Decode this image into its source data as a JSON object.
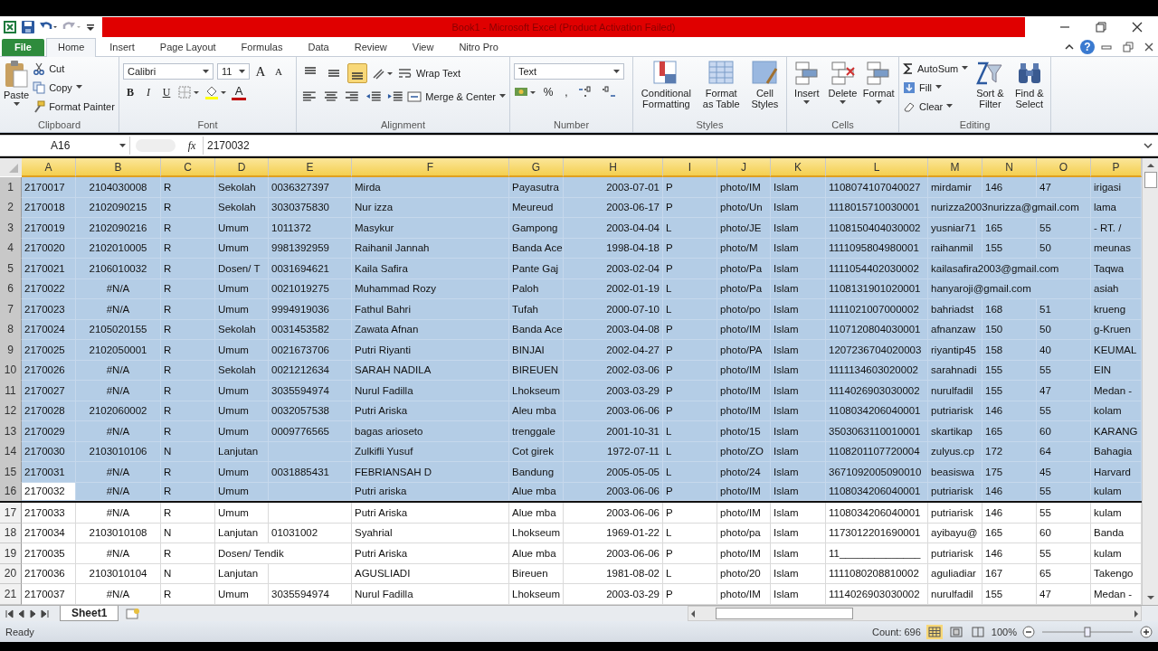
{
  "window": {
    "title": "Book1 - Microsoft Excel (Product Activation Failed)",
    "help": "?"
  },
  "ribbon_tabs": [
    {
      "label": "File",
      "kind": "file",
      "selected": false
    },
    {
      "label": "Home",
      "kind": "tab",
      "selected": true
    },
    {
      "label": "Insert",
      "kind": "tab",
      "selected": false
    },
    {
      "label": "Page Layout",
      "kind": "tab",
      "selected": false
    },
    {
      "label": "Formulas",
      "kind": "tab",
      "selected": false
    },
    {
      "label": "Data",
      "kind": "tab",
      "selected": false
    },
    {
      "label": "Review",
      "kind": "tab",
      "selected": false
    },
    {
      "label": "View",
      "kind": "tab",
      "selected": false
    },
    {
      "label": "Nitro Pro",
      "kind": "tab",
      "selected": false
    }
  ],
  "ribbon": {
    "clipboard": {
      "paste": "Paste",
      "cut": "Cut",
      "copy": "Copy",
      "format_painter": "Format Painter",
      "label": "Clipboard"
    },
    "font": {
      "name": "Calibri",
      "size": "11",
      "grow": "A",
      "shrink": "A",
      "bold": "B",
      "italic": "I",
      "underline": "U",
      "font_color": "A",
      "label": "Font"
    },
    "alignment": {
      "vertical": [
        {
          "selected": false
        },
        {
          "selected": false
        },
        {
          "selected": true
        }
      ],
      "wrap_text": "Wrap Text",
      "merge": "Merge & Center",
      "label": "Alignment"
    },
    "number": {
      "format": "Text",
      "percent": "%",
      "comma": ",",
      "label": "Number"
    },
    "styles": {
      "conditional": "Conditional Formatting",
      "table": "Format as Table",
      "cell": "Cell Styles",
      "label": "Styles"
    },
    "cells": {
      "insert": "Insert",
      "delete": "Delete",
      "format": "Format",
      "label": "Cells"
    },
    "editing": {
      "autosum": "AutoSum",
      "fill": "Fill",
      "clear": "Clear",
      "sort": "Sort & Filter",
      "find": "Find & Select",
      "label": "Editing"
    }
  },
  "formula_bar": {
    "name_box": "A16",
    "fx": "fx",
    "value": "2170032"
  },
  "table": {
    "columns": [
      {
        "label": "A",
        "selected": true
      },
      {
        "label": "B",
        "selected": true
      },
      {
        "label": "C",
        "selected": true
      },
      {
        "label": "D",
        "selected": true
      },
      {
        "label": "E",
        "selected": true
      },
      {
        "label": "F",
        "selected": true
      },
      {
        "label": "G",
        "selected": true
      },
      {
        "label": "H",
        "selected": true
      },
      {
        "label": "I",
        "selected": true
      },
      {
        "label": "J",
        "selected": true
      },
      {
        "label": "K",
        "selected": true
      },
      {
        "label": "L",
        "selected": true
      },
      {
        "label": "M",
        "selected": true
      },
      {
        "label": "N",
        "selected": true
      },
      {
        "label": "O",
        "selected": true
      },
      {
        "label": "P",
        "selected": true
      }
    ],
    "rows": [
      {
        "number": "1",
        "selected": true,
        "active": false,
        "cells": [
          "2170017",
          "2104030008",
          "R",
          "Sekolah",
          "0036327397",
          "Mirda",
          "Payasutra",
          "2003-07-01",
          "P",
          "photo/IM",
          "Islam",
          "1108074107040027",
          "mirdamir",
          "146",
          "47",
          "irigasi"
        ]
      },
      {
        "number": "2",
        "selected": true,
        "active": false,
        "cells": [
          "2170018",
          "2102090215",
          "R",
          "Sekolah",
          "3030375830",
          "Nur izza",
          "Meureud",
          "2003-06-17",
          "P",
          "photo/Un",
          "Islam",
          "1118015710030001",
          "nurizza2003nurizza@gmail.com",
          null,
          null,
          "lama"
        ]
      },
      {
        "number": "3",
        "selected": true,
        "active": false,
        "cells": [
          "2170019",
          "2102090216",
          "R",
          "Umum",
          "1011372",
          "Masykur",
          "Gampong",
          "2003-04-04",
          "L",
          "photo/JE",
          "Islam",
          "1108150404030002",
          "yusniar71",
          "165",
          "55",
          "- RT. /"
        ]
      },
      {
        "number": "4",
        "selected": true,
        "active": false,
        "cells": [
          "2170020",
          "2102010005",
          "R",
          "Umum",
          "9981392959",
          "Raihanil Jannah",
          "Banda Ace",
          "1998-04-18",
          "P",
          "photo/M",
          "Islam",
          "1111095804980001",
          "raihanmil",
          "155",
          "50",
          "meunas"
        ]
      },
      {
        "number": "5",
        "selected": true,
        "active": false,
        "cells": [
          "2170021",
          "2106010032",
          "R",
          "Dosen/ T",
          "0031694621",
          "Kaila Safira",
          "Pante Gaj",
          "2003-02-04",
          "P",
          "photo/Pa",
          "Islam",
          "1111054402030002",
          "kailasafira2003@gmail.com",
          null,
          null,
          "Taqwa"
        ]
      },
      {
        "number": "6",
        "selected": true,
        "active": false,
        "cells": [
          "2170022",
          "#N/A",
          "R",
          "Umum",
          "0021019275",
          "Muhammad Rozy",
          "Paloh",
          "2002-01-19",
          "L",
          "photo/Pa",
          "Islam",
          "1108131901020001",
          "hanyaroji@gmail.com",
          null,
          null,
          "asiah"
        ]
      },
      {
        "number": "7",
        "selected": true,
        "active": false,
        "cells": [
          "2170023",
          "#N/A",
          "R",
          "Umum",
          "9994919036",
          "Fathul Bahri",
          "Tufah",
          "2000-07-10",
          "L",
          "photo/po",
          "Islam",
          "1111021007000002",
          "bahriadst",
          "168",
          "51",
          "krueng"
        ]
      },
      {
        "number": "8",
        "selected": true,
        "active": false,
        "cells": [
          "2170024",
          "2105020155",
          "R",
          "Sekolah",
          "0031453582",
          "Zawata Afnan",
          "Banda Ace",
          "2003-04-08",
          "P",
          "photo/IM",
          "Islam",
          "1107120804030001",
          "afnanzaw",
          "150",
          "50",
          "g-Kruen"
        ]
      },
      {
        "number": "9",
        "selected": true,
        "active": false,
        "cells": [
          "2170025",
          "2102050001",
          "R",
          "Umum",
          "0021673706",
          "Putri Riyanti",
          "BINJAI",
          "2002-04-27",
          "P",
          "photo/PA",
          "Islam",
          "1207236704020003",
          "riyantip45",
          "158",
          "40",
          "KEUMAL"
        ]
      },
      {
        "number": "10",
        "selected": true,
        "active": false,
        "cells": [
          "2170026",
          "#N/A",
          "R",
          "Sekolah",
          "0021212634",
          "SARAH NADILA",
          "BIREUEN",
          "2002-03-06",
          "P",
          "photo/IM",
          "Islam",
          "1111134603020002",
          "sarahnadi",
          "155",
          "55",
          "EIN"
        ]
      },
      {
        "number": "11",
        "selected": true,
        "active": false,
        "cells": [
          "2170027",
          "#N/A",
          "R",
          "Umum",
          "3035594974",
          "Nurul Fadilla",
          "Lhokseum",
          "2003-03-29",
          "P",
          "photo/IM",
          "Islam",
          "1114026903030002",
          "nurulfadil",
          "155",
          "47",
          "Medan -"
        ]
      },
      {
        "number": "12",
        "selected": true,
        "active": false,
        "cells": [
          "2170028",
          "2102060002",
          "R",
          "Umum",
          "0032057538",
          "Putri Ariska",
          "Aleu mba",
          "2003-06-06",
          "P",
          "photo/IM",
          "Islam",
          "1108034206040001",
          "putriarisk",
          "146",
          "55",
          "kolam"
        ]
      },
      {
        "number": "13",
        "selected": true,
        "active": false,
        "cells": [
          "2170029",
          "#N/A",
          "R",
          "Umum",
          "0009776565",
          "bagas arioseto",
          "trenggale",
          "2001-10-31",
          "L",
          "photo/15",
          "Islam",
          "3503063110010001",
          "skartikap",
          "165",
          "60",
          "KARANG"
        ]
      },
      {
        "number": "14",
        "selected": true,
        "active": false,
        "cells": [
          "2170030",
          "2103010106",
          "N",
          "Lanjutan",
          null,
          "Zulkifli Yusuf",
          "Cot girek",
          "1972-07-11",
          "L",
          "photo/ZO",
          "Islam",
          "1108201107720004",
          "zulyus.cp",
          "172",
          "64",
          "Bahagia"
        ]
      },
      {
        "number": "15",
        "selected": true,
        "active": false,
        "cells": [
          "2170031",
          "#N/A",
          "R",
          "Umum",
          "0031885431",
          "FEBRIANSAH D",
          "Bandung",
          "2005-05-05",
          "L",
          "photo/24",
          "Islam",
          "3671092005090010",
          "beasiswa",
          "175",
          "45",
          "Harvard"
        ]
      },
      {
        "number": "16",
        "selected": true,
        "active": true,
        "cells": [
          "2170032",
          "#N/A",
          "R",
          "Umum",
          null,
          "Putri ariska",
          "Alue mba",
          "2003-06-06",
          "P",
          "photo/IM",
          "Islam",
          "1108034206040001",
          "putriarisk",
          "146",
          "55",
          "kulam"
        ]
      },
      {
        "number": "17",
        "selected": false,
        "active": false,
        "cells": [
          "2170033",
          "#N/A",
          "R",
          "Umum",
          null,
          "Putri Ariska",
          "Alue mba",
          "2003-06-06",
          "P",
          "photo/IM",
          "Islam",
          "1108034206040001",
          "putriarisk",
          "146",
          "55",
          "kulam"
        ]
      },
      {
        "number": "18",
        "selected": false,
        "active": false,
        "cells": [
          "2170034",
          "2103010108",
          "N",
          "Lanjutan",
          "01031002",
          "Syahrial",
          "Lhokseum",
          "1969-01-22",
          "L",
          "photo/pa",
          "Islam",
          "1173012201690001",
          "ayibayu@",
          "165",
          "60",
          "Banda"
        ]
      },
      {
        "number": "19",
        "selected": false,
        "active": false,
        "cells": [
          "2170035",
          "#N/A",
          "R",
          "Dosen/ Tendik",
          null,
          "Putri Ariska",
          "Alue mba",
          "2003-06-06",
          "P",
          "photo/IM",
          "Islam",
          "11______________",
          "putriarisk",
          "146",
          "55",
          "kulam"
        ]
      },
      {
        "number": "20",
        "selected": false,
        "active": false,
        "cells": [
          "2170036",
          "2103010104",
          "N",
          "Lanjutan",
          null,
          "AGUSLIADI",
          "Bireuen",
          "1981-08-02",
          "L",
          "photo/20",
          "Islam",
          "1111080208810002",
          "aguliadiar",
          "167",
          "65",
          "Takengo"
        ]
      },
      {
        "number": "21",
        "selected": false,
        "active": false,
        "cells": [
          "2170037",
          "#N/A",
          "R",
          "Umum",
          "3035594974",
          "Nurul Fadilla",
          "Lhokseum",
          "2003-03-29",
          "P",
          "photo/IM",
          "Islam",
          "1114026903030002",
          "nurulfadil",
          "155",
          "47",
          "Medan -"
        ]
      }
    ]
  },
  "sheet_tabs": [
    {
      "label": "Sheet1",
      "selected": true
    }
  ],
  "status_bar": {
    "mode": "Ready",
    "count": "Count: 696",
    "zoom": "100%",
    "zoom_slider": {
      "level": 0.5
    }
  }
}
